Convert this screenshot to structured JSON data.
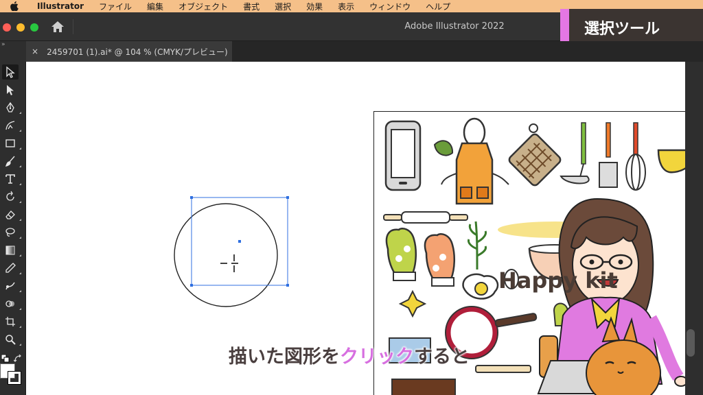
{
  "menubar": {
    "app_name": "Illustrator",
    "items": [
      "ファイル",
      "編集",
      "オブジェクト",
      "書式",
      "選択",
      "効果",
      "表示",
      "ウィンドウ",
      "ヘルプ"
    ]
  },
  "window": {
    "title": "Adobe Illustrator 2022"
  },
  "document_tab": {
    "close_label": "×",
    "title": "2459701 (1).ai* @ 104 % (CMYK/プレビュー)"
  },
  "toolbox_collapse": "»",
  "caption": {
    "text": "選択ツール"
  },
  "subtitle": {
    "before": "描いた図形を",
    "highlight": "クリック",
    "after": "すると"
  },
  "artwork_text": "Happy kit",
  "colors": {
    "menubar_bg": "#f5c089",
    "caption_accent": "#e477e4",
    "selection_blue": "#2f6fe0",
    "subtitle_highlight": "#d76fe0"
  },
  "tools": [
    "selection-tool",
    "direct-selection-tool",
    "pen-tool",
    "curvature-tool",
    "rectangle-tool",
    "paintbrush-tool",
    "type-tool",
    "rotate-tool",
    "eraser-tool",
    "lasso-tool",
    "gradient-tool",
    "eyedropper-tool",
    "blend-tool",
    "shape-builder-tool",
    "artboard-tool",
    "zoom-tool"
  ]
}
